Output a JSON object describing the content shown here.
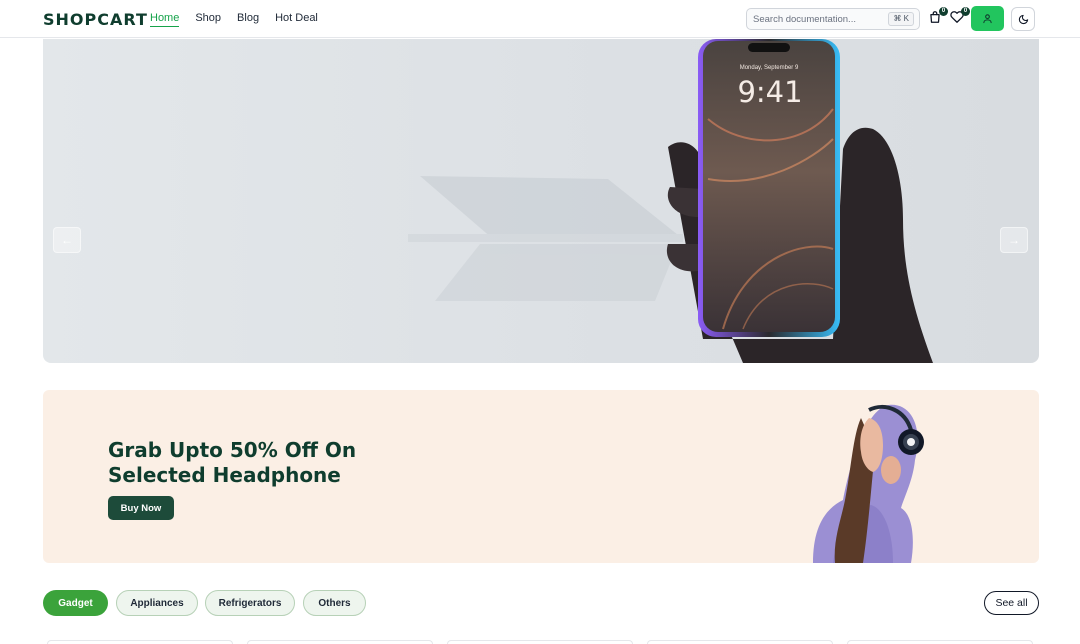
{
  "brand": {
    "name": "SHOPCART"
  },
  "nav": {
    "items": [
      "Home",
      "Shop",
      "Blog",
      "Hot Deal"
    ],
    "active": "Home"
  },
  "search": {
    "placeholder": "Search documentation...",
    "shortcut": "⌘ K"
  },
  "header_icons": {
    "cart": {
      "icon": "shopping-bag-icon",
      "count": "0"
    },
    "wishlist": {
      "icon": "heart-icon",
      "count": "0"
    },
    "user": {
      "icon": "user-icon"
    },
    "theme": {
      "icon": "moon-icon"
    }
  },
  "hero": {
    "phone_date": "Monday, September 9",
    "phone_time": "9:41",
    "prev_icon": "arrow-left-icon",
    "next_icon": "arrow-right-icon"
  },
  "promo": {
    "title_line1": "Grab Upto 50% Off On",
    "title_line2": "Selected Headphone",
    "button_label": "Buy Now"
  },
  "categories": {
    "items": [
      "Gadget",
      "Appliances",
      "Refrigerators",
      "Others"
    ],
    "active": "Gadget",
    "see_all_label": "See all"
  },
  "colors": {
    "brand": "#0f3d2e",
    "accent_green": "#22c55e",
    "active_tab": "#3ba33b",
    "promo_bg": "#fbefe5"
  }
}
